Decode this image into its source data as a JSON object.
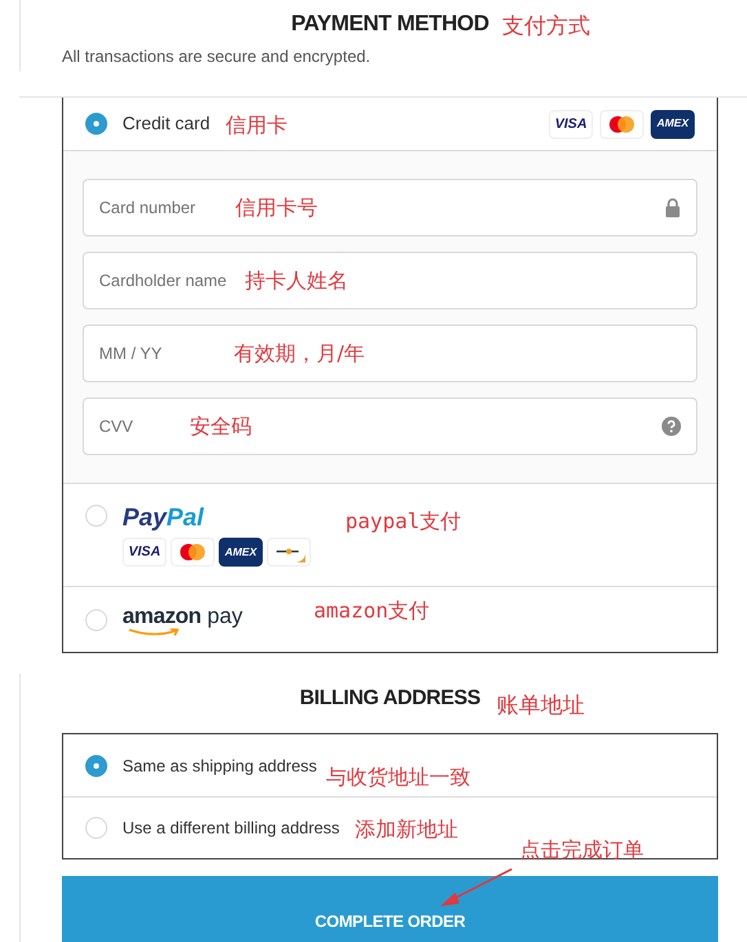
{
  "payment": {
    "title": "PAYMENT METHOD",
    "note": "支付方式",
    "subtitle": "All transactions are secure and encrypted.",
    "options": [
      {
        "kind": "card",
        "label": "Credit card",
        "note": "信用卡",
        "selected": true,
        "logos": [
          {
            "kind": "visa",
            "label": "VISA"
          },
          {
            "kind": "mastercard"
          },
          {
            "kind": "amex",
            "label": "AMEX"
          }
        ],
        "fields": [
          {
            "kind": "secure",
            "placeholder": "Card number",
            "note": "信用卡号"
          },
          {
            "kind": "text",
            "placeholder": "Cardholder name",
            "note": "持卡人姓名"
          },
          {
            "kind": "text",
            "placeholder": "MM / YY",
            "note": "有效期，月/年"
          },
          {
            "kind": "code",
            "placeholder": "CVV",
            "note": "安全码"
          }
        ]
      },
      {
        "kind": "paypal",
        "logo": [
          "Pay",
          "Pal"
        ],
        "note": "paypal支付",
        "selected": false,
        "logos": [
          {
            "kind": "visa",
            "label": "VISA"
          },
          {
            "kind": "mastercard"
          },
          {
            "kind": "amex",
            "label": "AMEX"
          },
          {
            "kind": "generic"
          }
        ]
      },
      {
        "kind": "amazon",
        "logo": [
          "amazon",
          "pay"
        ],
        "note": "amazon支付",
        "selected": false
      }
    ]
  },
  "billing": {
    "title": "BILLING ADDRESS",
    "note": "账单地址",
    "options": [
      {
        "label": "Same as shipping address",
        "note": "与收货地址一致",
        "selected": true
      },
      {
        "label": "Use a different billing address",
        "note": "添加新地址",
        "selected": false
      }
    ]
  },
  "complete": {
    "label": "COMPLETE ORDER",
    "note": "点击完成订单"
  }
}
